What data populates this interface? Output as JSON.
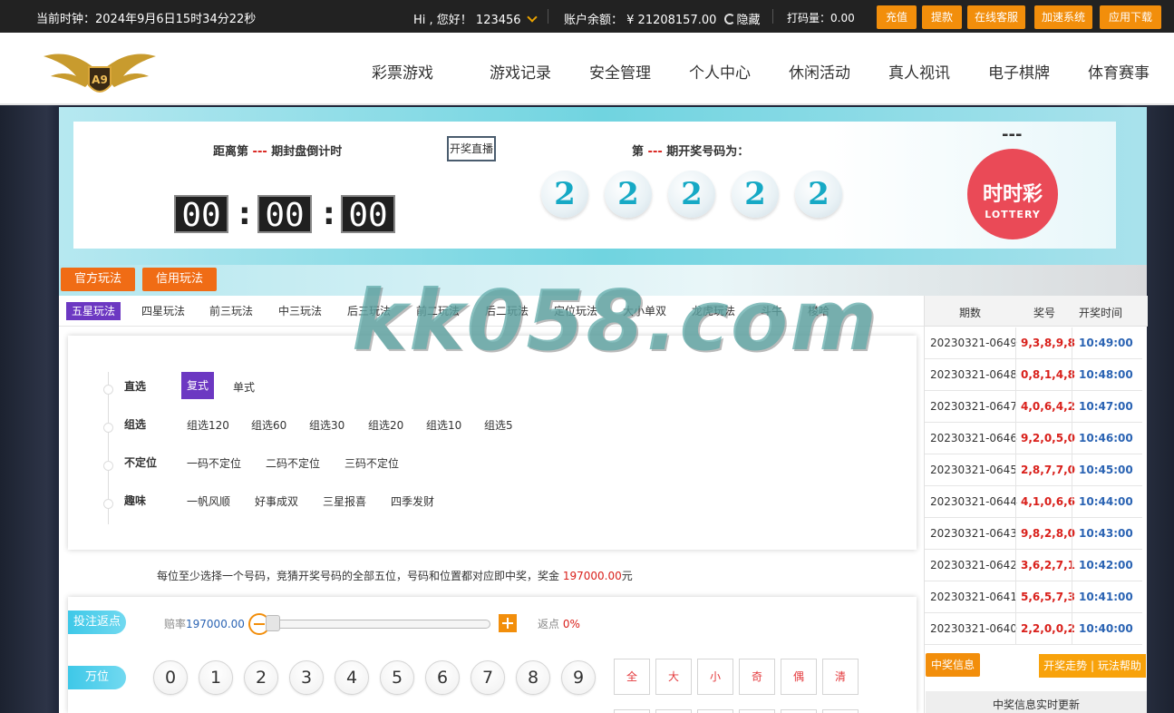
{
  "topbar": {
    "clock": "当前时钟：2024年9月6日15时34分22秒",
    "greeting": "Hi , 您好！ 123456",
    "balance_label": "账户余额：",
    "balance_value": "¥ 21208157.00",
    "hide_label": "隐藏",
    "bet_amount": "打码量：0.00",
    "buttons": [
      "充值",
      "提款",
      "在线客服",
      "加速系统",
      "应用下载"
    ]
  },
  "nav": {
    "items": [
      "彩票游戏",
      "游戏记录",
      "安全管理",
      "个人中心",
      "休闲活动",
      "真人视讯",
      "电子棋牌",
      "体育赛事"
    ],
    "logo_text": "A9"
  },
  "countdown": {
    "prefix": "距离第",
    "issue": "---",
    "suffix": "期封盘倒计时",
    "hours": "00",
    "minutes": "00",
    "seconds": "00",
    "live_button": "开奖直播"
  },
  "draw": {
    "prefix": "第",
    "issue": "---",
    "suffix": "期开奖号码为：",
    "numbers": [
      "2",
      "2",
      "2",
      "2",
      "2"
    ]
  },
  "lottery": {
    "dash": "---",
    "logo_cn": "时时彩",
    "logo_en": "LOTTERY"
  },
  "modes": [
    "官方玩法",
    "信用玩法"
  ],
  "play_tabs": [
    "五星玩法",
    "四星玩法",
    "前三玩法",
    "中三玩法",
    "后三玩法",
    "前二玩法",
    "后二玩法",
    "定位玩法",
    "大小单双",
    "龙虎玩法",
    "斗牛",
    "梭哈"
  ],
  "groups": [
    {
      "label": "直选",
      "options": [
        "复式",
        "单式"
      ]
    },
    {
      "label": "组选",
      "options": [
        "组选120",
        "组选60",
        "组选30",
        "组选20",
        "组选10",
        "组选5"
      ]
    },
    {
      "label": "不定位",
      "options": [
        "一码不定位",
        "二码不定位",
        "三码不定位"
      ]
    },
    {
      "label": "趣味",
      "options": [
        "一帆风顺",
        "好事成双",
        "三星报喜",
        "四季发财"
      ]
    }
  ],
  "description": {
    "text": "每位至少选择一个号码，竞猜开奖号码的全部五位，号码和位置都对应即中奖，奖金",
    "prize": "197000.00",
    "unit": "元"
  },
  "betting": {
    "rebate_tag": "投注返点",
    "odds_label": "赔率",
    "odds_value": "197000.00",
    "rebate_label": "返点",
    "rebate_value": "0%",
    "position_tag": "万位",
    "digits": [
      "0",
      "1",
      "2",
      "3",
      "4",
      "5",
      "6",
      "7",
      "8",
      "9"
    ],
    "quick": [
      "全",
      "大",
      "小",
      "奇",
      "偶",
      "清"
    ]
  },
  "results": {
    "headers": [
      "期数",
      "奖号",
      "开奖时间"
    ],
    "rows": [
      {
        "issue": "20230321-0649",
        "nums": "9,3,8,9,8",
        "time": "10:49:00"
      },
      {
        "issue": "20230321-0648",
        "nums": "0,8,1,4,8",
        "time": "10:48:00"
      },
      {
        "issue": "20230321-0647",
        "nums": "4,0,6,4,2",
        "time": "10:47:00"
      },
      {
        "issue": "20230321-0646",
        "nums": "9,2,0,5,0",
        "time": "10:46:00"
      },
      {
        "issue": "20230321-0645",
        "nums": "2,8,7,7,0",
        "time": "10:45:00"
      },
      {
        "issue": "20230321-0644",
        "nums": "4,1,0,6,6",
        "time": "10:44:00"
      },
      {
        "issue": "20230321-0643",
        "nums": "9,8,2,8,0",
        "time": "10:43:00"
      },
      {
        "issue": "20230321-0642",
        "nums": "3,6,2,7,1",
        "time": "10:42:00"
      },
      {
        "issue": "20230321-0641",
        "nums": "5,6,5,7,3",
        "time": "10:41:00"
      },
      {
        "issue": "20230321-0640",
        "nums": "2,2,0,0,2",
        "time": "10:40:00"
      }
    ],
    "win_button": "中奖信息",
    "trend_button": "开奖走势 | 玩法帮助",
    "realtime": "中奖信息实时更新"
  },
  "watermark": "kk058.com"
}
